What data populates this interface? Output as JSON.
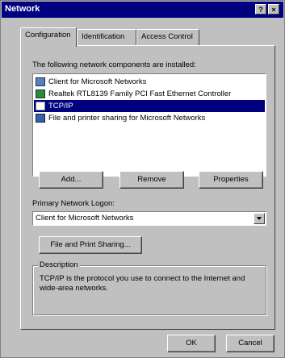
{
  "window": {
    "title": "Network",
    "help_button": "?",
    "close_button": "×"
  },
  "tabs": [
    {
      "label": "Configuration",
      "active": true
    },
    {
      "label": "Identification",
      "active": false
    },
    {
      "label": "Access Control",
      "active": false
    }
  ],
  "components": {
    "caption": "The following network components are installed:",
    "items": [
      {
        "label": "Client for Microsoft Networks",
        "icon": "network-client-icon",
        "selected": false
      },
      {
        "label": "Realtek RTL8139 Family PCI Fast Ethernet Controller",
        "icon": "network-adapter-icon",
        "selected": false
      },
      {
        "label": "TCP/IP",
        "icon": "protocol-icon",
        "selected": true
      },
      {
        "label": "File and printer sharing for Microsoft Networks",
        "icon": "service-icon",
        "selected": false
      }
    ]
  },
  "buttons": {
    "add": "Add...",
    "remove": "Remove",
    "properties": "Properties",
    "file_print_sharing": "File and Print Sharing...",
    "ok": "OK",
    "cancel": "Cancel"
  },
  "logon": {
    "label": "Primary Network Logon:",
    "value": "Client for Microsoft Networks"
  },
  "description": {
    "legend": "Description",
    "text": "TCP/IP is the protocol you use to connect to the Internet and wide-area networks."
  },
  "colors": {
    "titlebar": "#000080",
    "face": "#c0c0c0",
    "selection": "#000080"
  }
}
